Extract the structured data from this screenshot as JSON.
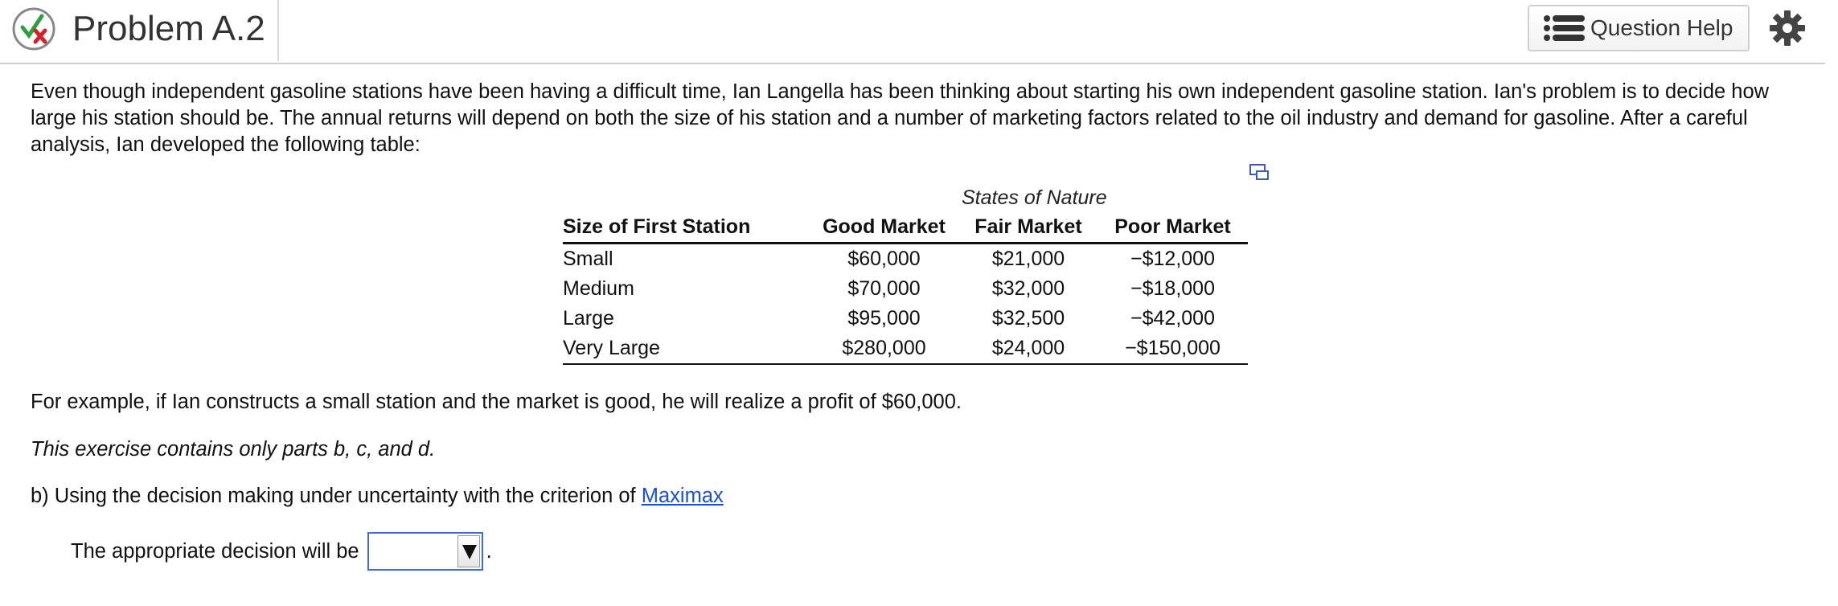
{
  "header": {
    "title": "Problem A.2",
    "help_label": "Question Help"
  },
  "intro": "Even though independent gasoline stations have been having a difficult time, Ian Langella has been thinking about starting his own independent gasoline station.  Ian's problem is to decide how large his station should be.  The annual returns will depend on both the size of his station and a number of marketing factors related to the oil industry and demand for gasoline.  After a careful analysis, Ian developed the following table:",
  "table": {
    "states_label": "States of Nature",
    "headers": [
      "Size of First Station",
      "Good Market",
      "Fair Market",
      "Poor Market"
    ],
    "rows": [
      [
        "Small",
        "$60,000",
        "$21,000",
        "−$12,000"
      ],
      [
        "Medium",
        "$70,000",
        "$32,000",
        "−$18,000"
      ],
      [
        "Large",
        "$95,000",
        "$32,500",
        "−$42,000"
      ],
      [
        "Very Large",
        "$280,000",
        "$24,000",
        "−$150,000"
      ]
    ]
  },
  "example": "For example, if Ian constructs a small station and the market is good, he will realize a profit of $60,000.",
  "parts_note": "This exercise contains only parts b, c, and d.",
  "question": {
    "prefix": "b) Using the decision making under uncertainty with the criterion of ",
    "link": "Maximax"
  },
  "answer": {
    "label": "The appropriate decision will be",
    "selected": "",
    "suffix": "."
  },
  "colors": {
    "link": "#1a4fd6",
    "dropdown_border": "#3b6fd8",
    "check_green": "#2e9e3e",
    "cross_red": "#d2232a"
  },
  "icons": [
    "status-check-x-icon",
    "list-icon",
    "gear-icon",
    "expand-table-icon",
    "dropdown-arrow-icon"
  ]
}
